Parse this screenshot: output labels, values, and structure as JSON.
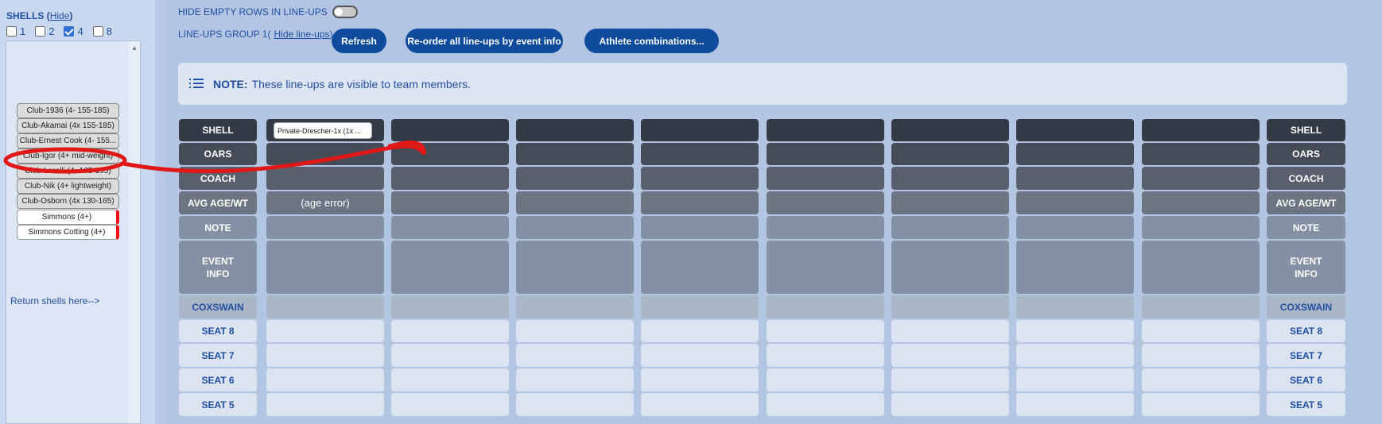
{
  "left": {
    "shells_title": "SHELLS",
    "hide_label": "Hide",
    "filters": [
      {
        "label": "1",
        "checked": false
      },
      {
        "label": "2",
        "checked": false
      },
      {
        "label": "4",
        "checked": true
      },
      {
        "label": "8",
        "checked": false
      }
    ],
    "shells": [
      "Club-1936 (4- 155-185)",
      "Club-Akamai (4x 155-185)",
      "Club-Ernest Cook (4- 155...",
      "Club-Igor (4+ mid-weight)",
      "Club-Lorelli (4- 165-195)",
      "Club-Nik (4+ lightweight)",
      "Club-Osborn (4x 130-165)",
      "Simmons (4+)",
      "Simmons Cotting (4+)"
    ],
    "return_label": "Return shells here-->"
  },
  "main": {
    "hide_empty_label": "HIDE EMPTY ROWS IN LINE-UPS",
    "group_label": "LINE-UPS GROUP 1",
    "hide_lineups_label": "Hide line-ups",
    "refresh_label": "Refresh",
    "reorder_label": "Re-order all line-ups by event info",
    "athlete_combos_label": "Athlete combinations...",
    "note_title": "NOTE:",
    "note_text": "These line-ups are visible to team members."
  },
  "grid": {
    "row_labels": [
      "SHELL",
      "OARS",
      "COACH",
      "AVG AGE/WT",
      "NOTE",
      "EVENT INFO",
      "COXSWAIN",
      "SEAT 8",
      "SEAT 7",
      "SEAT 6",
      "SEAT 5"
    ],
    "first_shell_value": "Private-Drescher-1x (1x ...",
    "first_avg_value": "(age error)"
  },
  "colors": {
    "accent": "#0f4c9e",
    "link": "#1f4fa3",
    "annotation": "#e01818"
  }
}
